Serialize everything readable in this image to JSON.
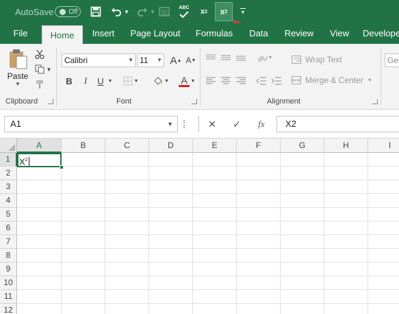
{
  "quick_access": {
    "autosave_label": "AutoSave",
    "autosave_state": "Off",
    "save_icon": "save-icon",
    "undo_icon": "undo-icon",
    "redo_icon": "redo-icon",
    "form_icon": "form-icon",
    "spelling_top": "ABC",
    "subscript_x": "x",
    "subscript_digit": "2",
    "superscript_x": "x",
    "superscript_digit": "2",
    "customize_icon": "customize-qat-icon"
  },
  "tabs": [
    "File",
    "Home",
    "Insert",
    "Page Layout",
    "Formulas",
    "Data",
    "Review",
    "View",
    "Develope"
  ],
  "active_tab": "Home",
  "ribbon": {
    "clipboard": {
      "paste_label": "Paste",
      "group_label": "Clipboard"
    },
    "font": {
      "font_name": "Calibri",
      "font_size": "11",
      "bold": "B",
      "italic": "I",
      "underline": "U",
      "font_color_letter": "A",
      "group_label": "Font",
      "font_color": "#e02020"
    },
    "alignment": {
      "wrap_text": "Wrap Text",
      "merge_center": "Merge & Center",
      "group_label": "Alignment"
    },
    "number": {
      "format_partial": "Ger"
    }
  },
  "formula_bar": {
    "name_box": "A1",
    "cancel_symbol": "✕",
    "enter_symbol": "✓",
    "fx_label": "fx",
    "content": "X2"
  },
  "grid": {
    "columns": [
      "A",
      "B",
      "C",
      "D",
      "E",
      "F",
      "G",
      "H",
      "I"
    ],
    "rows": [
      "1",
      "2",
      "3",
      "4",
      "5",
      "6",
      "7",
      "8",
      "9",
      "10",
      "11",
      "12"
    ],
    "active_cell": "A1",
    "a1_base": "X",
    "a1_superscript": "2"
  },
  "colors": {
    "accent": "#217346",
    "arrow": "#e53935"
  }
}
